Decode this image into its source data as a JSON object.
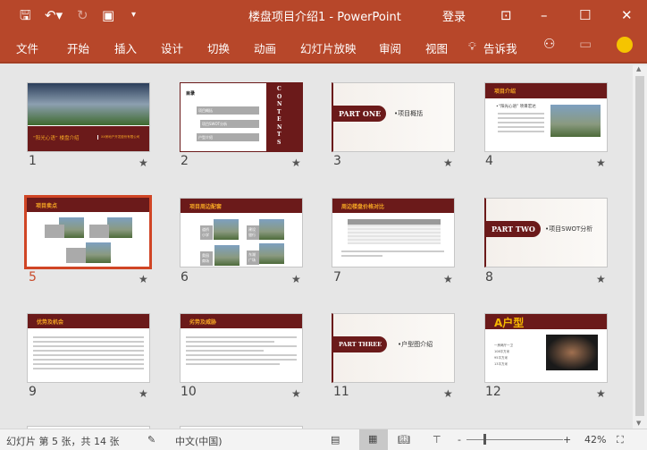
{
  "window": {
    "title": "楼盘项目介绍1  -  PowerPoint",
    "login": "登录"
  },
  "ribbon": {
    "tabs": [
      "文件",
      "开始",
      "插入",
      "设计",
      "切换",
      "动画",
      "幻灯片放映",
      "审阅",
      "视图"
    ],
    "tell_me": "告诉我"
  },
  "slides": [
    {
      "number": "1",
      "title": "“阳光心语” 楼盘介绍",
      "subtitle": "XX房地产开发股份有限公司"
    },
    {
      "number": "2",
      "heading": "目录",
      "side": "CONTENTS",
      "items": [
        "项目概括",
        "项目SWOT分析",
        "户型介绍"
      ]
    },
    {
      "number": "3",
      "part": "PART ONE",
      "sub": "•项目概括"
    },
    {
      "number": "4",
      "header": "项目介绍",
      "text": "•“阳光心语” 项目宏达"
    },
    {
      "number": "5",
      "header": "项目卖点"
    },
    {
      "number": "6",
      "header": "项目周边配套",
      "tags": [
        "道桥小学",
        "建设银行",
        "奥园商场",
        "东湖广场"
      ]
    },
    {
      "number": "7",
      "header": "周边楼盘价格对比"
    },
    {
      "number": "8",
      "part": "PART TWO",
      "sub": "•项目SWOT分析"
    },
    {
      "number": "9",
      "header": "优势及机会"
    },
    {
      "number": "10",
      "header": "劣势及威胁"
    },
    {
      "number": "11",
      "part": "PART THREE",
      "sub": "•户型图介绍"
    },
    {
      "number": "12",
      "header": "A户型",
      "bullets": [
        "一房两厅一卫",
        "108平方米",
        "95平方米",
        "13平方米"
      ]
    }
  ],
  "status": {
    "slide_info": "幻灯片 第 5 张，共 14 张",
    "language": "中文(中国)",
    "zoom": "42%",
    "zoom_percent": 42
  },
  "colors": {
    "brand": "#b7472a",
    "slide_dark": "#6b1a1a",
    "accent": "#f5a623",
    "selected": "#d04525"
  }
}
